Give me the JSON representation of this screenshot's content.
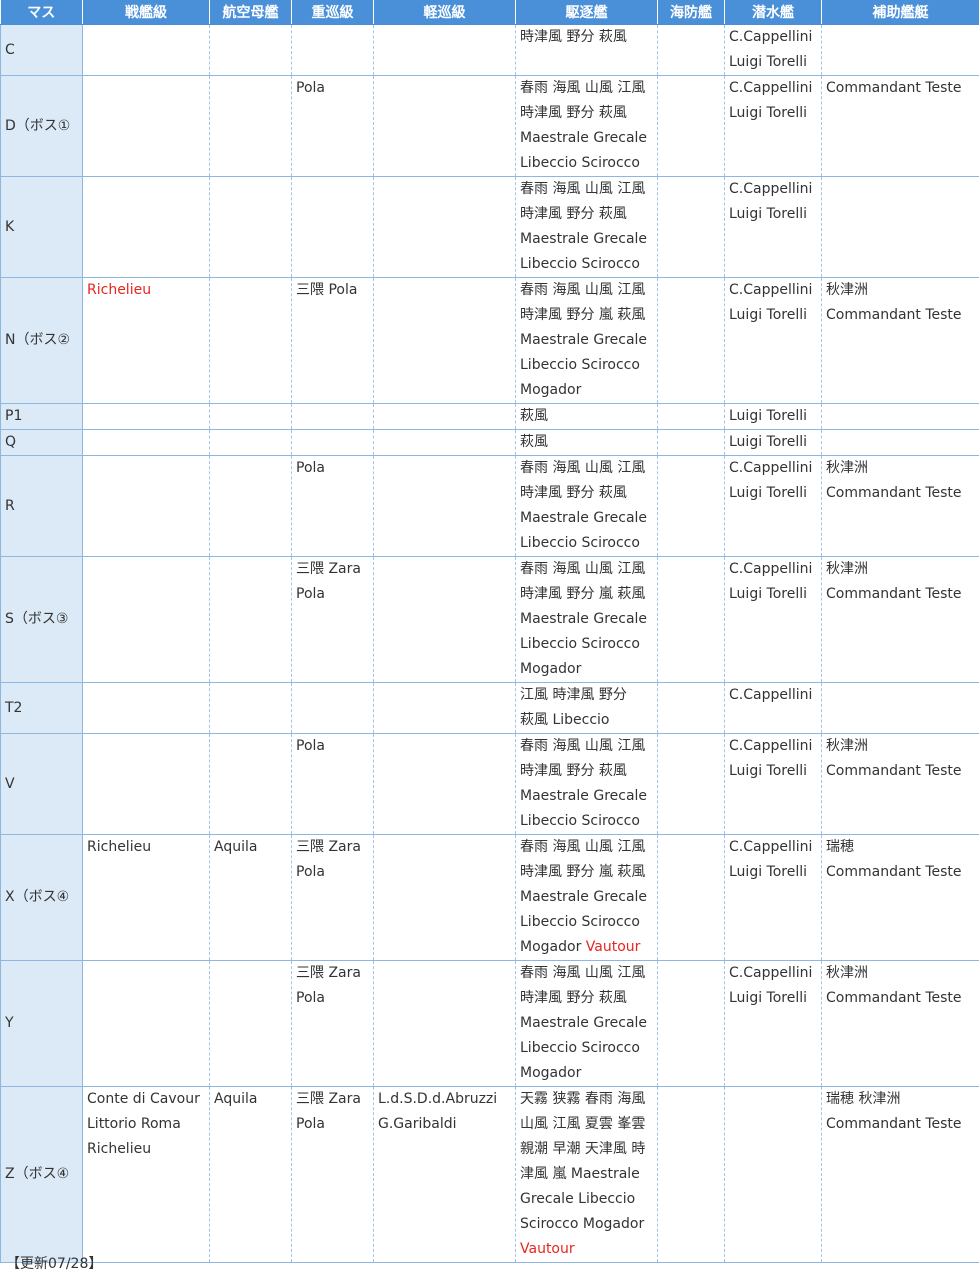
{
  "headers": [
    "マス",
    "戦艦級",
    "航空母艦",
    "重巡級",
    "軽巡級",
    "駆逐艦",
    "海防艦",
    "潜水艦",
    "補助艦艇"
  ],
  "rows": [
    {
      "node": "C",
      "cells": [
        [],
        [],
        [],
        [],
        [
          [
            {
              "t": "時津風 野分 萩風"
            }
          ]
        ],
        [],
        [
          [
            {
              "t": "C.Cappellini"
            }
          ],
          [
            {
              "t": "Luigi Torelli"
            }
          ]
        ],
        []
      ]
    },
    {
      "node": "D（ボス①",
      "cells": [
        [],
        [],
        [
          [
            {
              "t": "Pola"
            }
          ]
        ],
        [],
        [
          [
            {
              "t": "春雨 海風 山風 江風"
            }
          ],
          [
            {
              "t": "時津風 野分 萩風"
            }
          ],
          [
            {
              "t": "Maestrale Grecale"
            }
          ],
          [
            {
              "t": "Libeccio Scirocco"
            }
          ]
        ],
        [],
        [
          [
            {
              "t": "C.Cappellini"
            }
          ],
          [
            {
              "t": "Luigi Torelli"
            }
          ]
        ],
        [
          [
            {
              "t": "Commandant Teste"
            }
          ]
        ]
      ]
    },
    {
      "node": "K",
      "cells": [
        [],
        [],
        [],
        [],
        [
          [
            {
              "t": "春雨 海風 山風 江風"
            }
          ],
          [
            {
              "t": "時津風 野分 萩風"
            }
          ],
          [
            {
              "t": "Maestrale Grecale"
            }
          ],
          [
            {
              "t": "Libeccio Scirocco"
            }
          ]
        ],
        [],
        [
          [
            {
              "t": "C.Cappellini"
            }
          ],
          [
            {
              "t": "Luigi Torelli"
            }
          ]
        ],
        []
      ]
    },
    {
      "node": "N（ボス②",
      "cells": [
        [
          [
            {
              "t": "Richelieu",
              "r": true
            }
          ]
        ],
        [],
        [
          [
            {
              "t": "三隈 Pola"
            }
          ]
        ],
        [],
        [
          [
            {
              "t": "春雨 海風 山風 江風"
            }
          ],
          [
            {
              "t": "時津風 野分 嵐 萩風"
            }
          ],
          [
            {
              "t": "Maestrale Grecale"
            }
          ],
          [
            {
              "t": "Libeccio Scirocco"
            }
          ],
          [
            {
              "t": "Mogador"
            }
          ]
        ],
        [],
        [
          [
            {
              "t": "C.Cappellini"
            }
          ],
          [
            {
              "t": "Luigi Torelli"
            }
          ]
        ],
        [
          [
            {
              "t": "秋津洲"
            }
          ],
          [
            {
              "t": "Commandant Teste"
            }
          ]
        ]
      ]
    },
    {
      "node": "P1",
      "cells": [
        [],
        [],
        [],
        [],
        [
          [
            {
              "t": "萩風"
            }
          ]
        ],
        [],
        [
          [
            {
              "t": "Luigi Torelli"
            }
          ]
        ],
        []
      ]
    },
    {
      "node": "Q",
      "cells": [
        [],
        [],
        [],
        [],
        [
          [
            {
              "t": "萩風"
            }
          ]
        ],
        [],
        [
          [
            {
              "t": "Luigi Torelli"
            }
          ]
        ],
        []
      ]
    },
    {
      "node": "R",
      "cells": [
        [],
        [],
        [
          [
            {
              "t": "Pola"
            }
          ]
        ],
        [],
        [
          [
            {
              "t": "春雨 海風 山風 江風"
            }
          ],
          [
            {
              "t": "時津風 野分 萩風"
            }
          ],
          [
            {
              "t": "Maestrale Grecale"
            }
          ],
          [
            {
              "t": "Libeccio Scirocco"
            }
          ]
        ],
        [],
        [
          [
            {
              "t": "C.Cappellini"
            }
          ],
          [
            {
              "t": "Luigi Torelli"
            }
          ]
        ],
        [
          [
            {
              "t": "秋津洲"
            }
          ],
          [
            {
              "t": "Commandant Teste"
            }
          ]
        ]
      ]
    },
    {
      "node": "S（ボス③",
      "cells": [
        [],
        [],
        [
          [
            {
              "t": "三隈 Zara"
            }
          ],
          [
            {
              "t": "Pola"
            }
          ]
        ],
        [],
        [
          [
            {
              "t": "春雨 海風 山風 江風"
            }
          ],
          [
            {
              "t": "時津風 野分 嵐 萩風"
            }
          ],
          [
            {
              "t": "Maestrale Grecale"
            }
          ],
          [
            {
              "t": "Libeccio Scirocco"
            }
          ],
          [
            {
              "t": "Mogador"
            }
          ]
        ],
        [],
        [
          [
            {
              "t": "C.Cappellini"
            }
          ],
          [
            {
              "t": "Luigi Torelli"
            }
          ]
        ],
        [
          [
            {
              "t": "秋津洲"
            }
          ],
          [
            {
              "t": "Commandant Teste"
            }
          ]
        ]
      ]
    },
    {
      "node": "T2",
      "cells": [
        [],
        [],
        [],
        [],
        [
          [
            {
              "t": "江風 時津風 野分"
            }
          ],
          [
            {
              "t": "萩風 Libeccio"
            }
          ]
        ],
        [],
        [
          [
            {
              "t": "C.Cappellini"
            }
          ]
        ],
        []
      ]
    },
    {
      "node": "V",
      "cells": [
        [],
        [],
        [
          [
            {
              "t": "Pola"
            }
          ]
        ],
        [],
        [
          [
            {
              "t": "春雨 海風 山風 江風"
            }
          ],
          [
            {
              "t": "時津風 野分 萩風"
            }
          ],
          [
            {
              "t": "Maestrale Grecale"
            }
          ],
          [
            {
              "t": "Libeccio Scirocco"
            }
          ]
        ],
        [],
        [
          [
            {
              "t": "C.Cappellini"
            }
          ],
          [
            {
              "t": "Luigi Torelli"
            }
          ]
        ],
        [
          [
            {
              "t": "秋津洲"
            }
          ],
          [
            {
              "t": "Commandant Teste"
            }
          ]
        ]
      ]
    },
    {
      "node": "X（ボス④",
      "cells": [
        [
          [
            {
              "t": "Richelieu"
            }
          ]
        ],
        [
          [
            {
              "t": "Aquila"
            }
          ]
        ],
        [
          [
            {
              "t": "三隈 Zara"
            }
          ],
          [
            {
              "t": "Pola"
            }
          ]
        ],
        [],
        [
          [
            {
              "t": "春雨 海風 山風 江風"
            }
          ],
          [
            {
              "t": "時津風 野分 嵐 萩風"
            }
          ],
          [
            {
              "t": "Maestrale Grecale"
            }
          ],
          [
            {
              "t": "Libeccio Scirocco"
            }
          ],
          [
            {
              "t": "Mogador "
            },
            {
              "t": "Vautour",
              "r": true
            }
          ]
        ],
        [],
        [
          [
            {
              "t": "C.Cappellini"
            }
          ],
          [
            {
              "t": "Luigi Torelli"
            }
          ]
        ],
        [
          [
            {
              "t": "瑞穂"
            }
          ],
          [
            {
              "t": "Commandant Teste"
            }
          ]
        ]
      ]
    },
    {
      "node": "Y",
      "cells": [
        [],
        [],
        [
          [
            {
              "t": "三隈 Zara"
            }
          ],
          [
            {
              "t": "Pola"
            }
          ]
        ],
        [],
        [
          [
            {
              "t": "春雨 海風 山風 江風"
            }
          ],
          [
            {
              "t": "時津風 野分 萩風"
            }
          ],
          [
            {
              "t": "Maestrale Grecale"
            }
          ],
          [
            {
              "t": "Libeccio Scirocco"
            }
          ],
          [
            {
              "t": "Mogador"
            }
          ]
        ],
        [],
        [
          [
            {
              "t": "C.Cappellini"
            }
          ],
          [
            {
              "t": "Luigi Torelli"
            }
          ]
        ],
        [
          [
            {
              "t": "秋津洲"
            }
          ],
          [
            {
              "t": "Commandant Teste"
            }
          ]
        ]
      ]
    },
    {
      "node": "Z（ボス④",
      "cells": [
        [
          [
            {
              "t": "Conte di Cavour"
            }
          ],
          [
            {
              "t": "Littorio Roma"
            }
          ],
          [
            {
              "t": "Richelieu"
            }
          ]
        ],
        [
          [
            {
              "t": "Aquila"
            }
          ]
        ],
        [
          [
            {
              "t": "三隈 Zara"
            }
          ],
          [
            {
              "t": "Pola"
            }
          ]
        ],
        [
          [
            {
              "t": "L.d.S.D.d.Abruzzi"
            }
          ],
          [
            {
              "t": "G.Garibaldi"
            }
          ]
        ],
        [
          [
            {
              "t": "天霧 狭霧 春雨 海風"
            }
          ],
          [
            {
              "t": "山風 江風 夏雲 峯雲"
            }
          ],
          [
            {
              "t": "親潮 早潮 天津風 時"
            }
          ],
          [
            {
              "t": "津風 嵐 Maestrale"
            }
          ],
          [
            {
              "t": "Grecale Libeccio"
            }
          ],
          [
            {
              "t": "Scirocco Mogador"
            }
          ],
          [
            {
              "t": "Vautour",
              "r": true
            }
          ]
        ],
        [],
        [],
        [
          [
            {
              "t": "瑞穂 秋津洲"
            }
          ],
          [
            {
              "t": "Commandant Teste"
            }
          ]
        ]
      ]
    }
  ],
  "footer": "【更新07/28】",
  "colors": {
    "header_bg": "#4a90d9",
    "node_bg": "#dce9f6",
    "rare_text": "#e8251f",
    "border": "#8cb7e0"
  }
}
